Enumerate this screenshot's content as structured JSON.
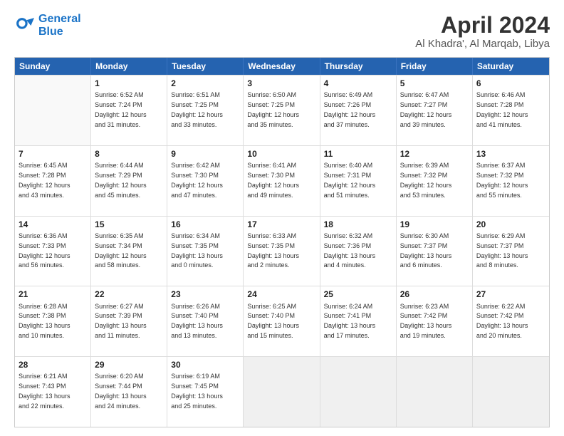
{
  "header": {
    "logo_line1": "General",
    "logo_line2": "Blue",
    "title": "April 2024",
    "subtitle": "Al Khadra', Al Marqab, Libya"
  },
  "weekdays": [
    "Sunday",
    "Monday",
    "Tuesday",
    "Wednesday",
    "Thursday",
    "Friday",
    "Saturday"
  ],
  "rows": [
    [
      {
        "day": "",
        "text": ""
      },
      {
        "day": "1",
        "text": "Sunrise: 6:52 AM\nSunset: 7:24 PM\nDaylight: 12 hours\nand 31 minutes."
      },
      {
        "day": "2",
        "text": "Sunrise: 6:51 AM\nSunset: 7:25 PM\nDaylight: 12 hours\nand 33 minutes."
      },
      {
        "day": "3",
        "text": "Sunrise: 6:50 AM\nSunset: 7:25 PM\nDaylight: 12 hours\nand 35 minutes."
      },
      {
        "day": "4",
        "text": "Sunrise: 6:49 AM\nSunset: 7:26 PM\nDaylight: 12 hours\nand 37 minutes."
      },
      {
        "day": "5",
        "text": "Sunrise: 6:47 AM\nSunset: 7:27 PM\nDaylight: 12 hours\nand 39 minutes."
      },
      {
        "day": "6",
        "text": "Sunrise: 6:46 AM\nSunset: 7:28 PM\nDaylight: 12 hours\nand 41 minutes."
      }
    ],
    [
      {
        "day": "7",
        "text": "Sunrise: 6:45 AM\nSunset: 7:28 PM\nDaylight: 12 hours\nand 43 minutes."
      },
      {
        "day": "8",
        "text": "Sunrise: 6:44 AM\nSunset: 7:29 PM\nDaylight: 12 hours\nand 45 minutes."
      },
      {
        "day": "9",
        "text": "Sunrise: 6:42 AM\nSunset: 7:30 PM\nDaylight: 12 hours\nand 47 minutes."
      },
      {
        "day": "10",
        "text": "Sunrise: 6:41 AM\nSunset: 7:30 PM\nDaylight: 12 hours\nand 49 minutes."
      },
      {
        "day": "11",
        "text": "Sunrise: 6:40 AM\nSunset: 7:31 PM\nDaylight: 12 hours\nand 51 minutes."
      },
      {
        "day": "12",
        "text": "Sunrise: 6:39 AM\nSunset: 7:32 PM\nDaylight: 12 hours\nand 53 minutes."
      },
      {
        "day": "13",
        "text": "Sunrise: 6:37 AM\nSunset: 7:32 PM\nDaylight: 12 hours\nand 55 minutes."
      }
    ],
    [
      {
        "day": "14",
        "text": "Sunrise: 6:36 AM\nSunset: 7:33 PM\nDaylight: 12 hours\nand 56 minutes."
      },
      {
        "day": "15",
        "text": "Sunrise: 6:35 AM\nSunset: 7:34 PM\nDaylight: 12 hours\nand 58 minutes."
      },
      {
        "day": "16",
        "text": "Sunrise: 6:34 AM\nSunset: 7:35 PM\nDaylight: 13 hours\nand 0 minutes."
      },
      {
        "day": "17",
        "text": "Sunrise: 6:33 AM\nSunset: 7:35 PM\nDaylight: 13 hours\nand 2 minutes."
      },
      {
        "day": "18",
        "text": "Sunrise: 6:32 AM\nSunset: 7:36 PM\nDaylight: 13 hours\nand 4 minutes."
      },
      {
        "day": "19",
        "text": "Sunrise: 6:30 AM\nSunset: 7:37 PM\nDaylight: 13 hours\nand 6 minutes."
      },
      {
        "day": "20",
        "text": "Sunrise: 6:29 AM\nSunset: 7:37 PM\nDaylight: 13 hours\nand 8 minutes."
      }
    ],
    [
      {
        "day": "21",
        "text": "Sunrise: 6:28 AM\nSunset: 7:38 PM\nDaylight: 13 hours\nand 10 minutes."
      },
      {
        "day": "22",
        "text": "Sunrise: 6:27 AM\nSunset: 7:39 PM\nDaylight: 13 hours\nand 11 minutes."
      },
      {
        "day": "23",
        "text": "Sunrise: 6:26 AM\nSunset: 7:40 PM\nDaylight: 13 hours\nand 13 minutes."
      },
      {
        "day": "24",
        "text": "Sunrise: 6:25 AM\nSunset: 7:40 PM\nDaylight: 13 hours\nand 15 minutes."
      },
      {
        "day": "25",
        "text": "Sunrise: 6:24 AM\nSunset: 7:41 PM\nDaylight: 13 hours\nand 17 minutes."
      },
      {
        "day": "26",
        "text": "Sunrise: 6:23 AM\nSunset: 7:42 PM\nDaylight: 13 hours\nand 19 minutes."
      },
      {
        "day": "27",
        "text": "Sunrise: 6:22 AM\nSunset: 7:42 PM\nDaylight: 13 hours\nand 20 minutes."
      }
    ],
    [
      {
        "day": "28",
        "text": "Sunrise: 6:21 AM\nSunset: 7:43 PM\nDaylight: 13 hours\nand 22 minutes."
      },
      {
        "day": "29",
        "text": "Sunrise: 6:20 AM\nSunset: 7:44 PM\nDaylight: 13 hours\nand 24 minutes."
      },
      {
        "day": "30",
        "text": "Sunrise: 6:19 AM\nSunset: 7:45 PM\nDaylight: 13 hours\nand 25 minutes."
      },
      {
        "day": "",
        "text": ""
      },
      {
        "day": "",
        "text": ""
      },
      {
        "day": "",
        "text": ""
      },
      {
        "day": "",
        "text": ""
      }
    ]
  ]
}
